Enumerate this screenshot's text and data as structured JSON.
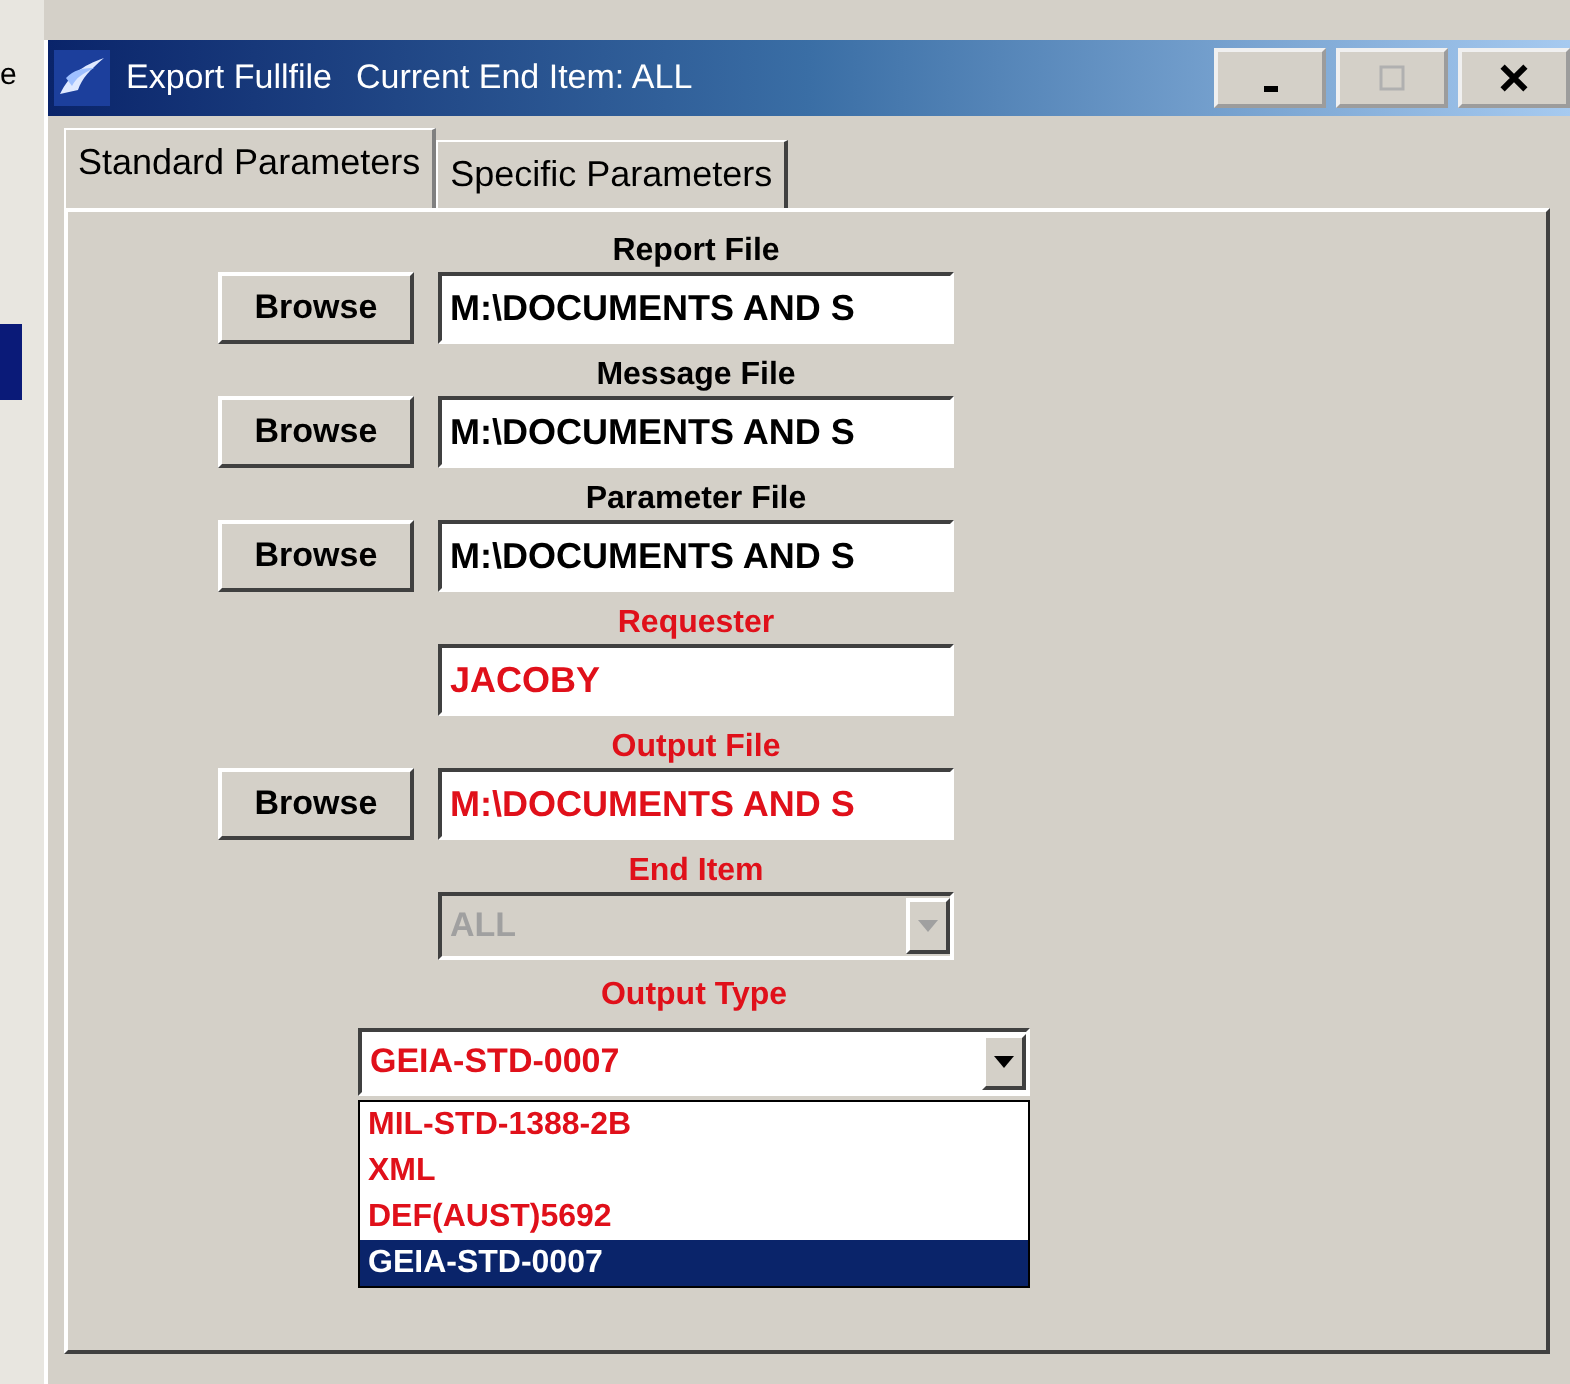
{
  "background_window": {
    "text": "e"
  },
  "window": {
    "title": "Export Fullfile",
    "subtitle": "Current End Item: ALL"
  },
  "tabs": [
    {
      "label": "Standard Parameters",
      "selected": true
    },
    {
      "label": "Specific Parameters",
      "selected": false
    }
  ],
  "fields": [
    {
      "kind": "file",
      "label": "Report File",
      "value": "M:\\DOCUMENTS AND S",
      "button": "Browse",
      "required": false
    },
    {
      "kind": "file",
      "label": "Message File",
      "value": "M:\\DOCUMENTS AND S",
      "button": "Browse",
      "required": false
    },
    {
      "kind": "file",
      "label": "Parameter File",
      "value": "M:\\DOCUMENTS AND S",
      "button": "Browse",
      "required": false
    },
    {
      "kind": "text",
      "label": "Requester",
      "value": "JACOBY",
      "required": true
    },
    {
      "kind": "file",
      "label": "Output File",
      "value": "M:\\DOCUMENTS AND S",
      "button": "Browse",
      "required": true
    },
    {
      "kind": "combo",
      "label": "End Item",
      "value": "ALL",
      "required": true,
      "disabled": true
    }
  ],
  "output_type": {
    "label": "Output Type",
    "value": "GEIA-STD-0007",
    "expanded": true,
    "options": [
      {
        "label": "MIL-STD-1388-2B",
        "selected": false
      },
      {
        "label": "XML",
        "selected": false
      },
      {
        "label": "DEF(AUST)5692",
        "selected": false
      },
      {
        "label": "GEIA-STD-0007",
        "selected": true
      }
    ]
  }
}
